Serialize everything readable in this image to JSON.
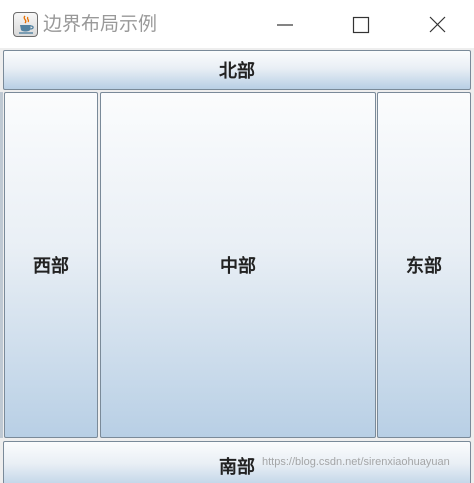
{
  "window": {
    "title": "边界布局示例",
    "icon": "java-cup-icon"
  },
  "controls": {
    "minimize_icon": "minimize-icon",
    "maximize_icon": "maximize-icon",
    "close_icon": "close-icon"
  },
  "buttons": {
    "north": "北部",
    "west": "西部",
    "center": "中部",
    "east": "东部",
    "south": "南部"
  },
  "watermark": "https://blog.csdn.net/sirenxiaohuayuan"
}
